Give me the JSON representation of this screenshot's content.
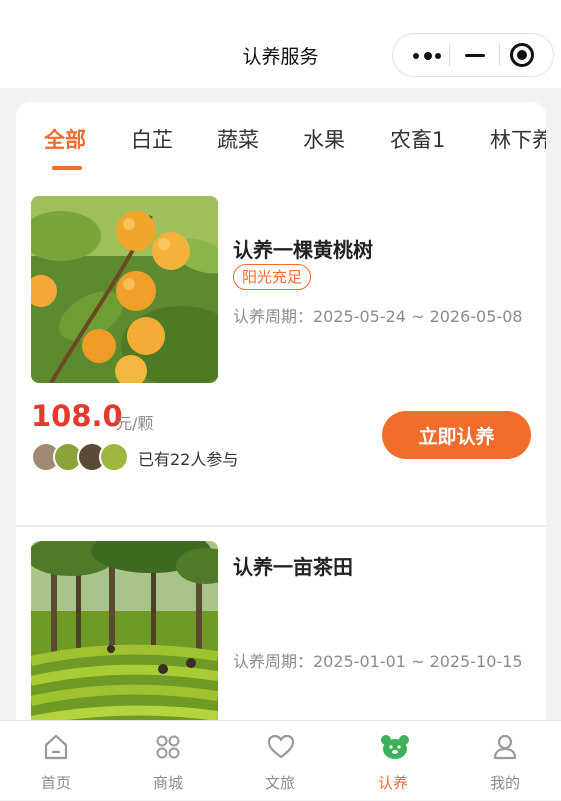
{
  "nav": {
    "title": "认养服务"
  },
  "tabs": [
    "全部",
    "白芷",
    "蔬菜",
    "水果",
    "农畜1",
    "林下养"
  ],
  "items": [
    {
      "title": "认养一棵黄桃树",
      "tag": "阳光充足",
      "period": "认养周期：2025-05-24 ~ 2026-05-08",
      "price": "108.0",
      "unit": "元/颗",
      "participants": "已有22人参与",
      "button": "立即认养"
    },
    {
      "title": "认养一亩茶田",
      "period": "认养周期：2025-01-01 ~ 2025-10-15"
    }
  ],
  "tabbar": [
    {
      "label": "首页",
      "icon": "home-icon"
    },
    {
      "label": "商城",
      "icon": "grid-icon"
    },
    {
      "label": "文旅",
      "icon": "heart-icon"
    },
    {
      "label": "认养",
      "icon": "bear-icon"
    },
    {
      "label": "我的",
      "icon": "user-icon"
    }
  ],
  "colors": {
    "accent": "#f26c2c",
    "price": "#e43a2c",
    "tabbar_active_icon": "#3db25a"
  }
}
